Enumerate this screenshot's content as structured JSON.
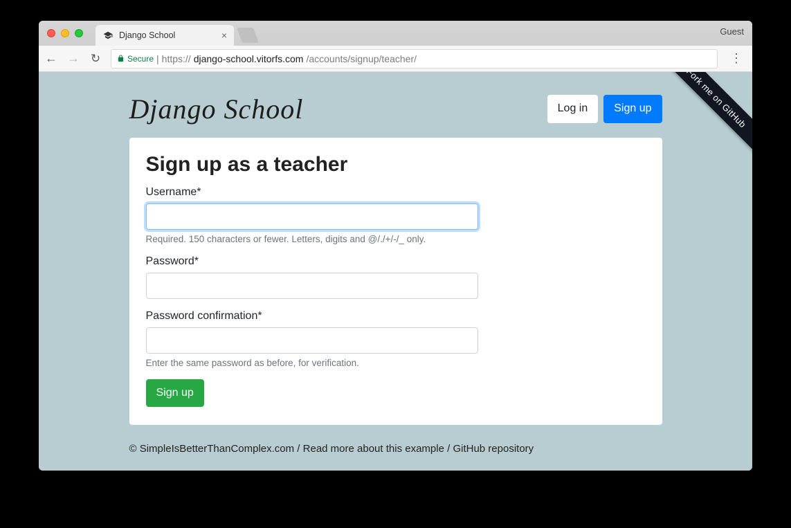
{
  "browser": {
    "tab_title": "Django School",
    "guest_label": "Guest",
    "secure_label": "Secure",
    "url_scheme": "https://",
    "url_host": "django-school.vitorfs.com",
    "url_path": "/accounts/signup/teacher/"
  },
  "site": {
    "brand": "Django School",
    "login_label": "Log in",
    "signup_label": "Sign up",
    "ribbon": "Fork me on GitHub"
  },
  "form": {
    "title": "Sign up as a teacher",
    "username_label": "Username*",
    "username_help": "Required. 150 characters or fewer. Letters, digits and @/./+/-/_ only.",
    "password_label": "Password*",
    "password_confirm_label": "Password confirmation*",
    "password_confirm_help": "Enter the same password as before, for verification.",
    "submit_label": "Sign up"
  },
  "footer": {
    "copyright": "© SimpleIsBetterThanComplex.com",
    "sep": " / ",
    "read_more": "Read more about this example",
    "repo": "GitHub repository"
  }
}
